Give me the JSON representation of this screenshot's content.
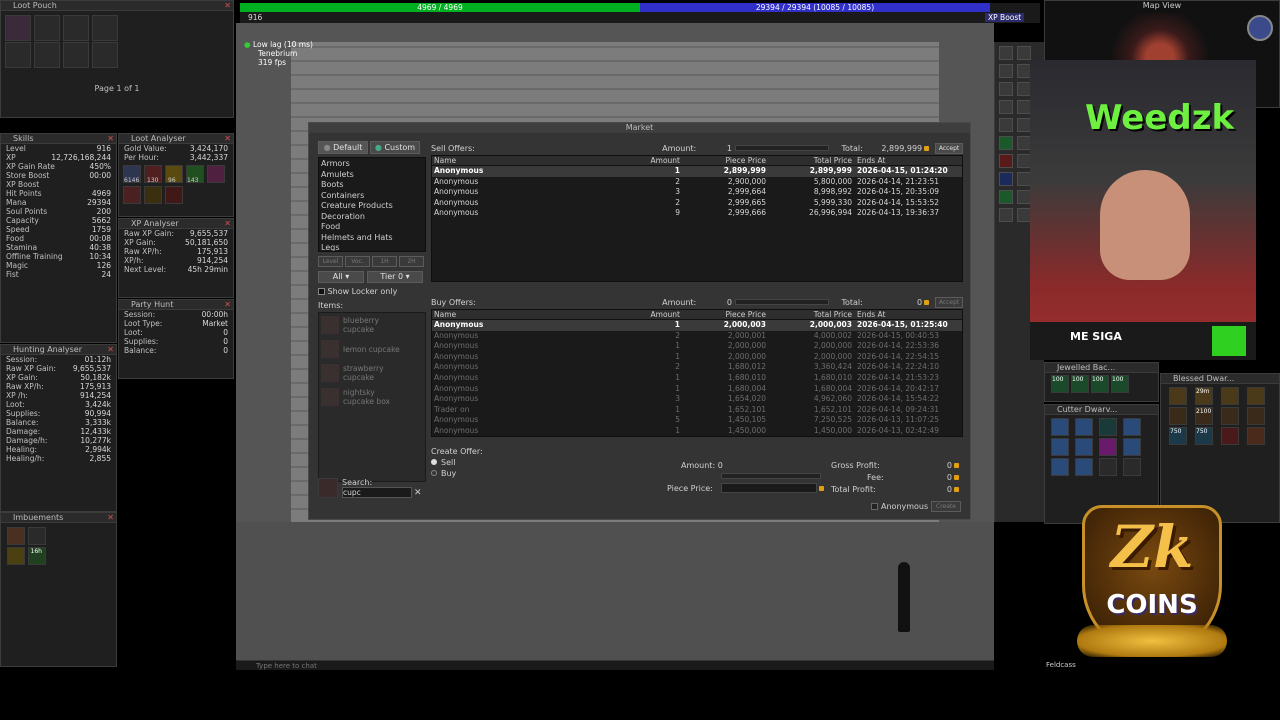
{
  "top_bars": {
    "health": "4969 / 4969",
    "mana": "29394 / 29394 (10085 / 10085)",
    "xp_boost_label": "XP Boost",
    "level_indicator": "916"
  },
  "status": {
    "lag": "Low lag (10 ms)",
    "server": "Tenebrium",
    "fps": "319 fps"
  },
  "loot_pouch": {
    "title": "Loot Pouch",
    "page": "Page 1 of 1"
  },
  "skills": {
    "title": "Skills",
    "rows": [
      {
        "label": "Level",
        "value": "916"
      },
      {
        "label": "XP",
        "value": "12,726,168,244"
      },
      {
        "label": "XP Gain Rate",
        "value": "450%"
      },
      {
        "label": "Store Boost",
        "value": "00:00"
      },
      {
        "label": "XP Boost",
        "value": ""
      },
      {
        "label": "Hit Points",
        "value": "4969"
      },
      {
        "label": "Mana",
        "value": "29394"
      },
      {
        "label": "Soul Points",
        "value": "200"
      },
      {
        "label": "Capacity",
        "value": "5662"
      },
      {
        "label": "Speed",
        "value": "1759"
      },
      {
        "label": "Food",
        "value": "00:08"
      },
      {
        "label": "Stamina",
        "value": "40:38"
      },
      {
        "label": "Offline Training",
        "value": "10:34"
      },
      {
        "label": "Magic",
        "value": "126"
      },
      {
        "label": "Fist",
        "value": "24"
      }
    ]
  },
  "hunting_analyser": {
    "title": "Hunting Analyser",
    "rows": [
      {
        "label": "Session:",
        "value": "01:12h"
      },
      {
        "label": "Raw XP Gain:",
        "value": "9,655,537"
      },
      {
        "label": "XP Gain:",
        "value": "50,182k"
      },
      {
        "label": "Raw XP/h:",
        "value": "175,913"
      },
      {
        "label": "XP /h:",
        "value": "914,254"
      },
      {
        "label": "Loot:",
        "value": "3,424k"
      },
      {
        "label": "Supplies:",
        "value": "90,994"
      },
      {
        "label": "Balance:",
        "value": "3,333k"
      },
      {
        "label": "Damage:",
        "value": "12,433k"
      },
      {
        "label": "Damage/h:",
        "value": "10,277k"
      },
      {
        "label": "Healing:",
        "value": "2,994k"
      },
      {
        "label": "Healing/h:",
        "value": "2,855"
      }
    ]
  },
  "imbuements": {
    "title": "Imbuements",
    "timer": "16h"
  },
  "loot_analyser": {
    "title": "Loot Analyser",
    "rows": [
      {
        "label": "Gold Value:",
        "value": "3,424,170"
      },
      {
        "label": "Per Hour:",
        "value": "3,442,337"
      }
    ],
    "item_counts": [
      "6146",
      "130",
      "96",
      "143"
    ]
  },
  "xp_analyser": {
    "title": "XP Analyser",
    "rows": [
      {
        "label": "Raw XP Gain:",
        "value": "9,655,537"
      },
      {
        "label": "XP Gain:",
        "value": "50,181,650"
      },
      {
        "label": "Raw XP/h:",
        "value": "175,913"
      },
      {
        "label": "XP/h:",
        "value": "914,254"
      },
      {
        "label": "Next Level:",
        "value": "45h 29min"
      }
    ]
  },
  "party_hunt": {
    "title": "Party Hunt",
    "rows": [
      {
        "label": "Session:",
        "value": "00:00h"
      },
      {
        "label": "Loot Type:",
        "value": "Market"
      },
      {
        "label": "Loot:",
        "value": "0"
      },
      {
        "label": "Supplies:",
        "value": "0"
      },
      {
        "label": "Balance:",
        "value": "0"
      }
    ]
  },
  "market": {
    "title": "Market",
    "tabs": [
      "Default",
      "Custom"
    ],
    "categories": [
      "Armors",
      "Amulets",
      "Boots",
      "Containers",
      "Creature Products",
      "Decoration",
      "Food",
      "Helmets and Hats",
      "Legs"
    ],
    "filters": {
      "level": "Level",
      "voc": "Voc.",
      "oh": "1H",
      "th": "2H",
      "all": "All",
      "tier": "Tier 0",
      "show_locker": "Show Locker only"
    },
    "items_label": "Items:",
    "items": [
      {
        "name": "blueberry\ncupcake",
        "dim": true
      },
      {
        "name": "lemon cupcake",
        "dim": true
      },
      {
        "name": "strawberry\ncupcake",
        "dim": true
      },
      {
        "name": "nightsky\ncupcake box",
        "dim": true
      }
    ],
    "search_label": "Search:",
    "search_value": "cupc",
    "sell_offers": {
      "label": "Sell Offers:",
      "amount_label": "Amount:",
      "amount": "1",
      "total_label": "Total:",
      "total": "2,899,999",
      "accept": "Accept",
      "columns": [
        "Name",
        "Amount",
        "Piece Price",
        "Total Price",
        "Ends At"
      ],
      "rows": [
        [
          "Anonymous",
          "1",
          "2,899,999",
          "2,899,999",
          "2026-04-15, 01:24:20"
        ],
        [
          "Anonymous",
          "2",
          "2,900,000",
          "5,800,000",
          "2026-04-14, 21:23:51"
        ],
        [
          "Anonymous",
          "3",
          "2,999,664",
          "8,998,992",
          "2026-04-15, 20:35:09"
        ],
        [
          "Anonymous",
          "2",
          "2,999,665",
          "5,999,330",
          "2026-04-14, 15:53:52"
        ],
        [
          "Anonymous",
          "9",
          "2,999,666",
          "26,996,994",
          "2026-04-13, 19:36:37"
        ]
      ]
    },
    "buy_offers": {
      "label": "Buy Offers:",
      "amount_label": "Amount:",
      "amount": "0",
      "total_label": "Total:",
      "total": "0",
      "accept": "Accept",
      "columns": [
        "Name",
        "Amount",
        "Piece Price",
        "Total Price",
        "Ends At"
      ],
      "rows": [
        [
          "Anonymous",
          "1",
          "2,000,003",
          "2,000,003",
          "2026-04-15, 01:25:40"
        ],
        [
          "Anonymous",
          "2",
          "2,000,001",
          "4,000,002",
          "2026-04-15, 00:40:53"
        ],
        [
          "Anonymous",
          "1",
          "2,000,000",
          "2,000,000",
          "2026-04-14, 22:53:36"
        ],
        [
          "Anonymous",
          "1",
          "2,000,000",
          "2,000,000",
          "2026-04-14, 22:54:15"
        ],
        [
          "Anonymous",
          "2",
          "1,680,012",
          "3,360,424",
          "2026-04-14, 22:24:10"
        ],
        [
          "Anonymous",
          "1",
          "1,680,010",
          "1,680,010",
          "2026-04-14, 21:53:23"
        ],
        [
          "Anonymous",
          "1",
          "1,680,004",
          "1,680,004",
          "2026-04-14, 20:42:17"
        ],
        [
          "Anonymous",
          "3",
          "1,654,020",
          "4,962,060",
          "2026-04-14, 15:54:22"
        ],
        [
          "Trader on",
          "1",
          "1,652,101",
          "1,652,101",
          "2026-04-14, 09:24:31"
        ],
        [
          "Anonymous",
          "5",
          "1,450,105",
          "7,250,525",
          "2026-04-13, 11:07:25"
        ],
        [
          "Anonymous",
          "1",
          "1,450,000",
          "1,450,000",
          "2026-04-13, 02:42:49"
        ]
      ]
    },
    "create_offer": {
      "label": "Create Offer:",
      "sell": "Sell",
      "buy": "Buy",
      "amount_label": "Amount:",
      "amount": "0",
      "piece_price_label": "Piece Price:",
      "gross_profit_label": "Gross Profit:",
      "gross_profit": "0",
      "fee_label": "Fee:",
      "fee": "0",
      "total_profit_label": "Total Profit:",
      "total_profit": "0",
      "anonymous": "Anonymous",
      "create": "Create"
    }
  },
  "map_view": {
    "title": "Map View"
  },
  "webcam": {
    "streamer": "Weedzk",
    "overlay_text": "ME SIGA"
  },
  "containers": [
    {
      "title": "Jewelled Bac...",
      "counts": [
        "100",
        "100",
        "100",
        "100"
      ]
    },
    {
      "title": "Blessed Dwar...",
      "counts": [
        "29m",
        "2100",
        "750",
        "750"
      ]
    },
    {
      "title": "Cutter Dwarv..."
    }
  ],
  "zk_logo": {
    "line1": "Zk",
    "line2": "COINS"
  },
  "chat": {
    "placeholder": "Type here to chat",
    "tab": "Feldcass"
  },
  "colors": {
    "health": "#00b020",
    "mana": "#3030c8",
    "accent": "#e0a010",
    "logo_gold": "#f5c04a"
  }
}
